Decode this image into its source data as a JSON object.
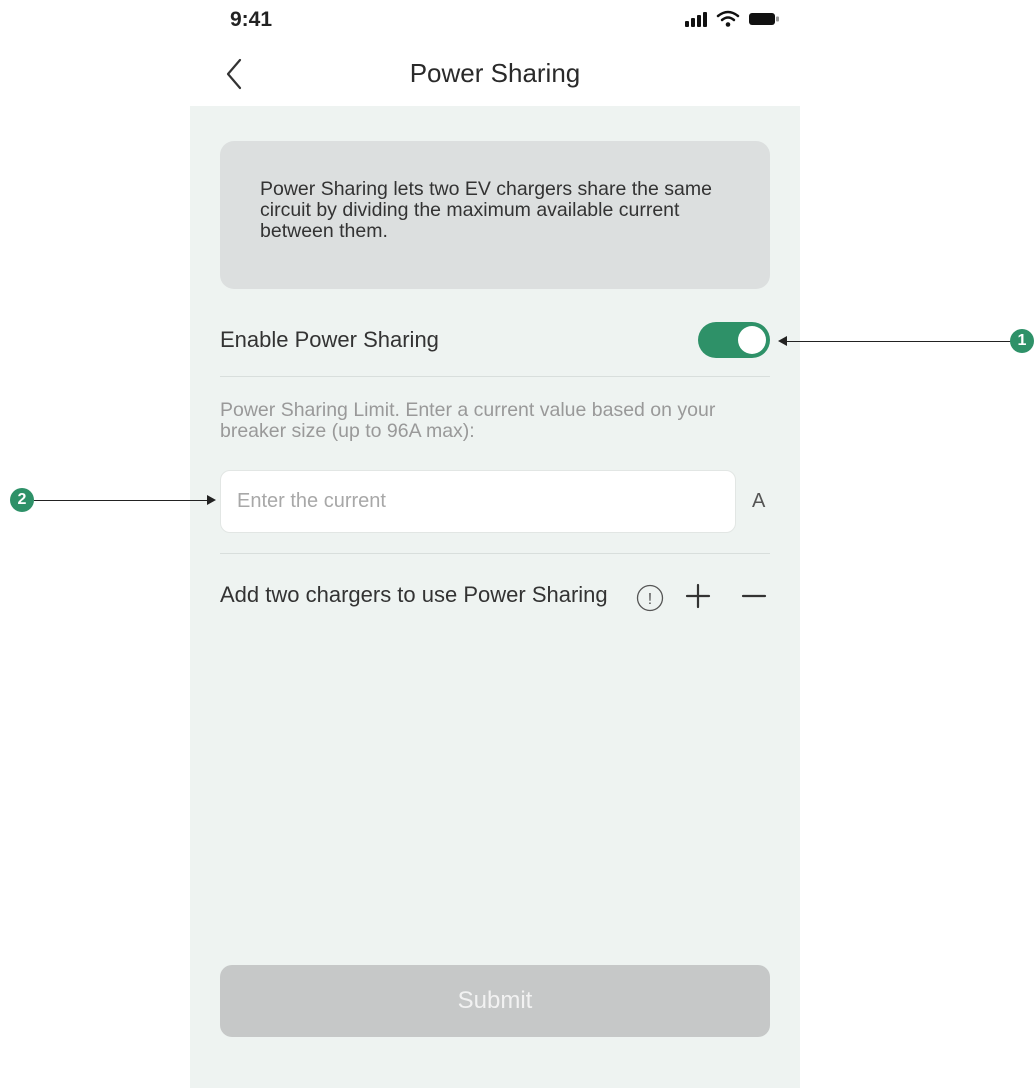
{
  "status_bar": {
    "time": "9:41"
  },
  "header": {
    "title": "Power Sharing"
  },
  "info_card": {
    "text": "Power Sharing lets two EV chargers share the same circuit by dividing the maximum available current between them."
  },
  "enable": {
    "label": "Enable  Power Sharing",
    "enabled": true
  },
  "limit": {
    "help_text": "Power Sharing Limit. Enter a current value based on your breaker size (up to 96A max):",
    "placeholder": "Enter the current",
    "value": "",
    "unit": "A"
  },
  "chargers": {
    "label": "Add two chargers to use Power Sharing",
    "info_icon": "!"
  },
  "submit": {
    "label": "Submit"
  },
  "callouts": {
    "one": "1",
    "two": "2"
  },
  "colors": {
    "accent": "#2e9168",
    "background": "#eef3f1",
    "card": "#dcdfdf",
    "disabled_button": "#c6c8c8"
  }
}
